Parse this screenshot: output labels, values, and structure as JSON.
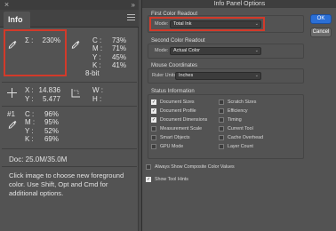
{
  "info_panel": {
    "tab_label": "Info",
    "first_readout": {
      "sigma": "Σ :",
      "value": "230%"
    },
    "cmyk_readout": {
      "labels": [
        "C :",
        "M :",
        "Y :",
        "K :"
      ],
      "values": [
        "73%",
        "71%",
        "45%",
        "41%"
      ],
      "bit_depth": "8-bit"
    },
    "coords": {
      "x_label": "X :",
      "x_value": "14.836",
      "y_label": "Y :",
      "y_value": "5.477"
    },
    "size": {
      "w_label": "W :",
      "h_label": "H :"
    },
    "sample1": {
      "id": "#1",
      "labels": [
        "C :",
        "M :",
        "Y :",
        "K :"
      ],
      "values": [
        "96%",
        "95%",
        "52%",
        "69%"
      ]
    },
    "doc": "Doc: 25.0M/35.0M",
    "help_text": "Click image to choose new foreground color.  Use Shift, Opt and Cmd for additional options."
  },
  "dialog": {
    "title": "Info Panel Options",
    "ok_label": "OK",
    "cancel_label": "Cancel",
    "first_color": {
      "heading": "First Color Readout",
      "mode_label": "Mode:",
      "mode_value": "Total Ink"
    },
    "second_color": {
      "heading": "Second Color Readout",
      "mode_label": "Mode:",
      "mode_value": "Actual Color"
    },
    "mouse": {
      "heading": "Mouse Coordinates",
      "units_label": "Ruler Units:",
      "units_value": "Inches"
    },
    "status": {
      "heading": "Status Information",
      "left": [
        {
          "label": "Document Sizes",
          "checked": true
        },
        {
          "label": "Document Profile",
          "checked": true
        },
        {
          "label": "Document Dimensions",
          "checked": true
        },
        {
          "label": "Measurement Scale",
          "checked": false
        },
        {
          "label": "Smart Objects",
          "checked": false
        },
        {
          "label": "GPU Mode",
          "checked": false
        }
      ],
      "right": [
        {
          "label": "Scratch Sizes",
          "checked": false
        },
        {
          "label": "Efficiency",
          "checked": false
        },
        {
          "label": "Timing",
          "checked": false
        },
        {
          "label": "Current Tool",
          "checked": false
        },
        {
          "label": "Cache Overhead",
          "checked": false
        },
        {
          "label": "Layer Count",
          "checked": false
        }
      ]
    },
    "always_composite": {
      "label": "Always Show Composite Color Values",
      "checked": false
    },
    "tool_hints": {
      "label": "Show Tool Hints",
      "checked": true
    },
    "colors": {
      "highlight": "#d23a2a",
      "accent": "#2b6fd6"
    }
  }
}
